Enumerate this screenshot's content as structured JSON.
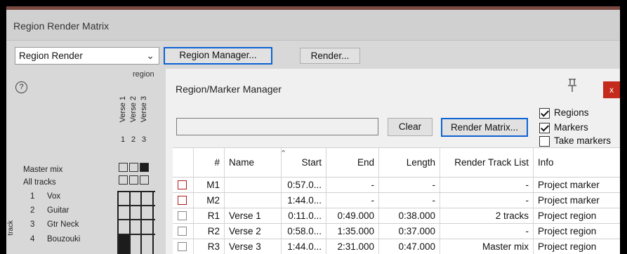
{
  "window": {
    "title": "Region Render Matrix",
    "source_combo": "Region Render",
    "region_manager_button": "Region Manager...",
    "render_button": "Render...",
    "help_label": "?",
    "region_header": "region",
    "track_axis_label": "track",
    "regions": [
      {
        "num": "1",
        "name": "Verse 1"
      },
      {
        "num": "2",
        "name": "Verse 2"
      },
      {
        "num": "3",
        "name": "Verse 3"
      }
    ],
    "rows": [
      {
        "num": "",
        "name": "Master mix",
        "cells": [
          false,
          false,
          true
        ]
      },
      {
        "num": "",
        "name": "All tracks",
        "cells": [
          false,
          false,
          false
        ]
      },
      {
        "num": "1",
        "name": "Vox"
      },
      {
        "num": "2",
        "name": "Guitar"
      },
      {
        "num": "3",
        "name": "Gtr Neck"
      },
      {
        "num": "4",
        "name": "Bouzouki"
      }
    ]
  },
  "manager": {
    "title": "Region/Marker Manager",
    "close_label": "x",
    "filter_value": "",
    "clear_button": "Clear",
    "render_matrix_button": "Render Matrix...",
    "options": [
      {
        "label": "Regions",
        "checked": true
      },
      {
        "label": "Markers",
        "checked": true
      },
      {
        "label": "Take markers",
        "checked": false
      }
    ],
    "columns": [
      "#",
      "Name",
      "Start",
      "End",
      "Length",
      "Render Track List",
      "Info"
    ],
    "rows": [
      {
        "kind": "marker",
        "id": "M1",
        "name": "",
        "start": "0:57.0...",
        "end": "-",
        "length": "-",
        "render": "-",
        "info": "Project marker"
      },
      {
        "kind": "marker",
        "id": "M2",
        "name": "",
        "start": "1:44.0...",
        "end": "-",
        "length": "-",
        "render": "-",
        "info": "Project marker"
      },
      {
        "kind": "region",
        "id": "R1",
        "name": "Verse 1",
        "start": "0:11.0...",
        "end": "0:49.000",
        "length": "0:38.000",
        "render": "2 tracks",
        "info": "Project region"
      },
      {
        "kind": "region",
        "id": "R2",
        "name": "Verse 2",
        "start": "0:58.0...",
        "end": "1:35.000",
        "length": "0:37.000",
        "render": "-",
        "info": "Project region"
      },
      {
        "kind": "region",
        "id": "R3",
        "name": "Verse 3",
        "start": "1:44.0...",
        "end": "2:31.000",
        "length": "0:47.000",
        "render": "Master mix",
        "info": "Project region"
      }
    ]
  },
  "colors": {
    "accent_focus": "#0b62d6",
    "close_red": "#c42b1c",
    "marker_swatch": "#b01818"
  }
}
